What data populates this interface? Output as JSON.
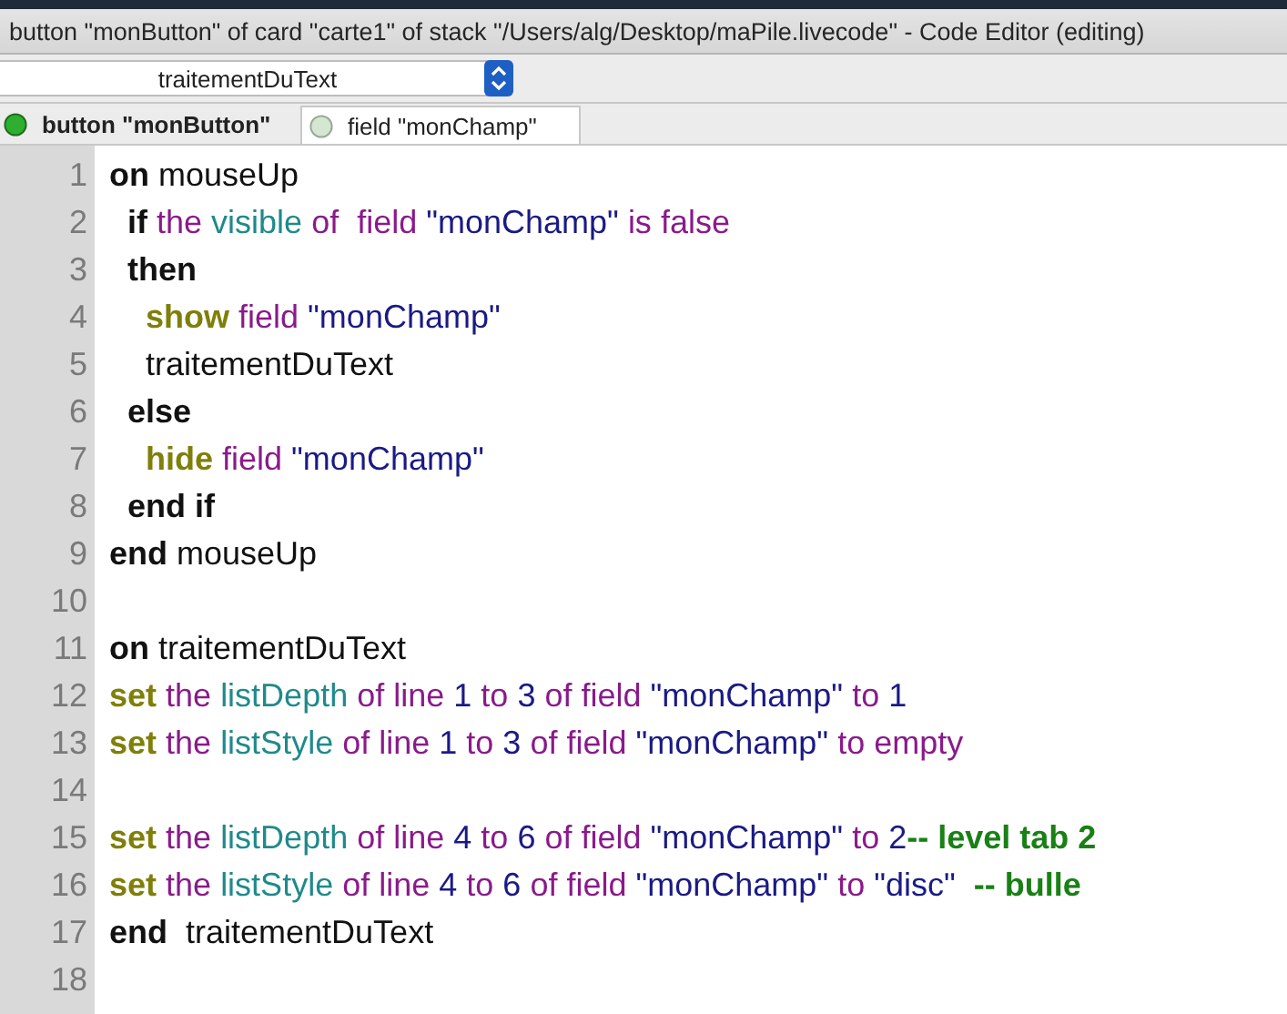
{
  "window": {
    "title": "button \"monButton\" of card \"carte1\" of stack \"/Users/alg/Desktop/maPile.livecode\" - Code Editor (editing)"
  },
  "handler_menu": {
    "value": "traitementDuText"
  },
  "tabs": [
    {
      "label": "button \"monButton\"",
      "selected": true
    },
    {
      "label": "field \"monChamp\"",
      "selected": false
    }
  ],
  "code": [
    {
      "number": "1",
      "tokens": [
        {
          "kind": "keyword",
          "text": "on "
        },
        {
          "kind": "plain",
          "text": "mouseUp"
        }
      ]
    },
    {
      "number": "2",
      "tokens": [
        {
          "kind": "keyword",
          "text": "  if "
        },
        {
          "kind": "chunk",
          "text": "the "
        },
        {
          "kind": "property",
          "text": "visible "
        },
        {
          "kind": "chunk",
          "text": "of  field "
        },
        {
          "kind": "string",
          "text": "\"monChamp\" "
        },
        {
          "kind": "chunk",
          "text": "is false"
        }
      ]
    },
    {
      "number": "3",
      "tokens": [
        {
          "kind": "keyword",
          "text": "  then"
        }
      ]
    },
    {
      "number": "4",
      "tokens": [
        {
          "kind": "command",
          "text": "    show "
        },
        {
          "kind": "chunk",
          "text": "field "
        },
        {
          "kind": "string",
          "text": "\"monChamp\""
        }
      ]
    },
    {
      "number": "5",
      "tokens": [
        {
          "kind": "plain",
          "text": "    traitementDuText"
        }
      ]
    },
    {
      "number": "6",
      "tokens": [
        {
          "kind": "keyword",
          "text": "  else"
        }
      ]
    },
    {
      "number": "7",
      "tokens": [
        {
          "kind": "command",
          "text": "    hide "
        },
        {
          "kind": "chunk",
          "text": "field "
        },
        {
          "kind": "string",
          "text": "\"monChamp\""
        }
      ]
    },
    {
      "number": "8",
      "tokens": [
        {
          "kind": "keyword",
          "text": "  end if"
        }
      ]
    },
    {
      "number": "9",
      "tokens": [
        {
          "kind": "keyword",
          "text": "end "
        },
        {
          "kind": "plain",
          "text": "mouseUp"
        }
      ]
    },
    {
      "number": "10"
    },
    {
      "number": "11",
      "tokens": [
        {
          "kind": "keyword",
          "text": "on "
        },
        {
          "kind": "plain",
          "text": "traitementDuText"
        }
      ]
    },
    {
      "number": "12",
      "tokens": [
        {
          "kind": "command",
          "text": "set "
        },
        {
          "kind": "chunk",
          "text": "the "
        },
        {
          "kind": "property",
          "text": "listDepth "
        },
        {
          "kind": "chunk",
          "text": "of line "
        },
        {
          "kind": "string",
          "text": "1 "
        },
        {
          "kind": "chunk",
          "text": "to "
        },
        {
          "kind": "string",
          "text": "3 "
        },
        {
          "kind": "chunk",
          "text": "of field "
        },
        {
          "kind": "string",
          "text": "\"monChamp\" "
        },
        {
          "kind": "chunk",
          "text": "to "
        },
        {
          "kind": "string",
          "text": "1"
        }
      ]
    },
    {
      "number": "13",
      "tokens": [
        {
          "kind": "command",
          "text": "set "
        },
        {
          "kind": "chunk",
          "text": "the "
        },
        {
          "kind": "property",
          "text": "listStyle "
        },
        {
          "kind": "chunk",
          "text": "of line "
        },
        {
          "kind": "string",
          "text": "1 "
        },
        {
          "kind": "chunk",
          "text": "to "
        },
        {
          "kind": "string",
          "text": "3 "
        },
        {
          "kind": "chunk",
          "text": "of field "
        },
        {
          "kind": "string",
          "text": "\"monChamp\" "
        },
        {
          "kind": "chunk",
          "text": "to empty"
        }
      ]
    },
    {
      "number": "14"
    },
    {
      "number": "15",
      "tokens": [
        {
          "kind": "command",
          "text": "set "
        },
        {
          "kind": "chunk",
          "text": "the "
        },
        {
          "kind": "property",
          "text": "listDepth "
        },
        {
          "kind": "chunk",
          "text": "of line "
        },
        {
          "kind": "string",
          "text": "4 "
        },
        {
          "kind": "chunk",
          "text": "to "
        },
        {
          "kind": "string",
          "text": "6 "
        },
        {
          "kind": "chunk",
          "text": "of field "
        },
        {
          "kind": "string",
          "text": "\"monChamp\" "
        },
        {
          "kind": "chunk",
          "text": "to "
        },
        {
          "kind": "string",
          "text": "2"
        },
        {
          "kind": "comment",
          "text": "-- level tab 2"
        }
      ]
    },
    {
      "number": "16",
      "tokens": [
        {
          "kind": "command",
          "text": "set "
        },
        {
          "kind": "chunk",
          "text": "the "
        },
        {
          "kind": "property",
          "text": "listStyle "
        },
        {
          "kind": "chunk",
          "text": "of line "
        },
        {
          "kind": "string",
          "text": "4 "
        },
        {
          "kind": "chunk",
          "text": "to "
        },
        {
          "kind": "string",
          "text": "6 "
        },
        {
          "kind": "chunk",
          "text": "of field "
        },
        {
          "kind": "string",
          "text": "\"monChamp\" "
        },
        {
          "kind": "chunk",
          "text": "to "
        },
        {
          "kind": "string",
          "text": "\"disc\""
        },
        {
          "kind": "comment",
          "text": "  -- bulle"
        }
      ]
    },
    {
      "number": "17",
      "tokens": [
        {
          "kind": "keyword",
          "text": "end  "
        },
        {
          "kind": "plain",
          "text": "traitementDuText"
        }
      ]
    },
    {
      "number": "18"
    }
  ]
}
